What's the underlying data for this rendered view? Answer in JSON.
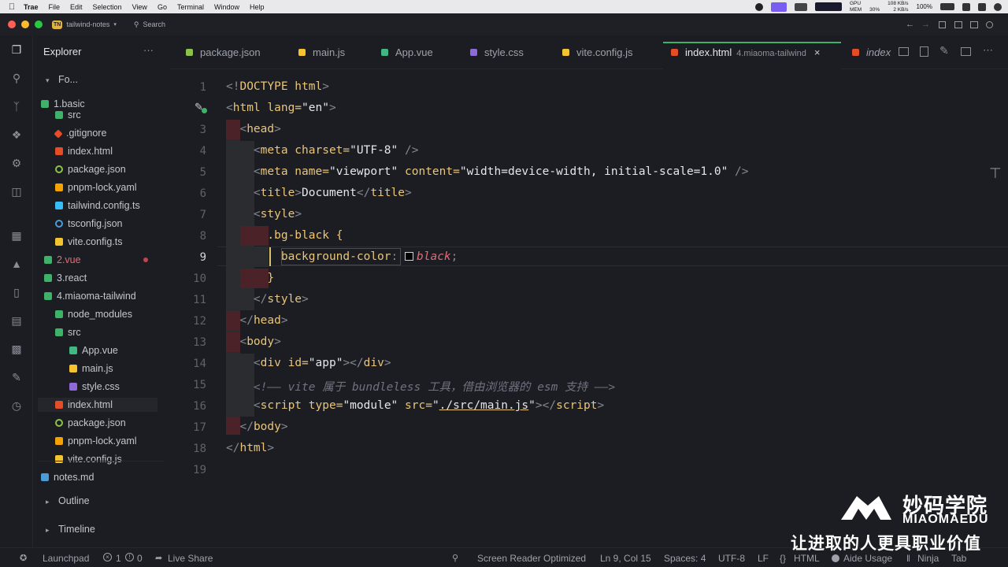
{
  "menubar": {
    "items": [
      "Trae",
      "File",
      "Edit",
      "Selection",
      "View",
      "Go",
      "Terminal",
      "Window",
      "Help"
    ],
    "gpu_label": "GPU",
    "mem_label": "MEM",
    "mem_value": "30%",
    "net_up": "108 KB/s",
    "net_down": "2 KB/s",
    "battery": "100%"
  },
  "titlebar": {
    "project_badge": "TN",
    "project_name": "tailwind-notes",
    "search_label": "Search"
  },
  "sidebar": {
    "title": "Explorer",
    "more": "···",
    "root_label": "Fo...",
    "outline_label": "Outline",
    "timeline_label": "Timeline",
    "rows": [
      {
        "label": "1.basic",
        "kind": "folder"
      },
      {
        "label": "src",
        "kind": "folder-src"
      },
      {
        "label": ".gitignore",
        "kind": "git"
      },
      {
        "label": "index.html",
        "kind": "html"
      },
      {
        "label": "package.json",
        "kind": "json"
      },
      {
        "label": "pnpm-lock.yaml",
        "kind": "yaml"
      },
      {
        "label": "tailwind.config.ts",
        "kind": "tw"
      },
      {
        "label": "tsconfig.json",
        "kind": "json-blue"
      },
      {
        "label": "vite.config.ts",
        "kind": "vite"
      },
      {
        "label": "2.vue",
        "kind": "folder-mod"
      },
      {
        "label": "3.react",
        "kind": "folder"
      },
      {
        "label": "4.miaoma-tailwind",
        "kind": "folder"
      },
      {
        "label": "node_modules",
        "kind": "folder"
      },
      {
        "label": "src",
        "kind": "folder-src"
      },
      {
        "label": "App.vue",
        "kind": "vue"
      },
      {
        "label": "main.js",
        "kind": "js"
      },
      {
        "label": "style.css",
        "kind": "css"
      },
      {
        "label": "index.html",
        "kind": "html"
      },
      {
        "label": "package.json",
        "kind": "json"
      },
      {
        "label": "pnpm-lock.yaml",
        "kind": "yaml"
      },
      {
        "label": "vite.config.js",
        "kind": "vite"
      },
      {
        "label": "notes.md",
        "kind": "md"
      }
    ]
  },
  "tabs": [
    {
      "label": "package.json",
      "color": "#8bc34a"
    },
    {
      "label": "main.js",
      "color": "#f4c430"
    },
    {
      "label": "App.vue",
      "color": "#41b883"
    },
    {
      "label": "style.css",
      "color": "#8e6ad8"
    },
    {
      "label": "vite.config.js",
      "color": "#f4c430"
    },
    {
      "label": "index.html",
      "color": "#e44d26",
      "hint": "4.miaoma-tailwind",
      "close": "×"
    },
    {
      "label": "index",
      "color": "#e44d26"
    }
  ],
  "editor": {
    "line_numbers": [
      "1",
      "2",
      "3",
      "4",
      "5",
      "6",
      "7",
      "8",
      "9",
      "10",
      "11",
      "12",
      "13",
      "14",
      "15",
      "16",
      "17",
      "18",
      "19"
    ],
    "code": {
      "l1a": "<!",
      "l1b": "DOCTYPE html",
      "l1c": ">",
      "l2a": "<",
      "l2b": "html",
      "l2c": " lang=",
      "l2d": "\"en\"",
      "l2e": ">",
      "l3a": "<",
      "l3b": "head",
      "l3c": ">",
      "l4a": "<",
      "l4b": "meta",
      "l4c": " charset=",
      "l4d": "\"UTF-8\"",
      "l4e": " />",
      "l5a": "<",
      "l5b": "meta",
      "l5c": " name=",
      "l5d": "\"viewport\"",
      "l5e": " content=",
      "l5f": "\"width=device-width, initial-scale=1.0\"",
      "l5g": " />",
      "l6a": "<",
      "l6b": "title",
      "l6c": ">",
      "l6d": "Document",
      "l6e": "</",
      "l6f": "title",
      "l6g": ">",
      "l7a": "<",
      "l7b": "style",
      "l7c": ">",
      "l8a": ".bg-black",
      "l8b": " {",
      "l9a": "background-color",
      "l9b": ": ",
      "l9c": "black",
      "l9d": ";",
      "l10a": "}",
      "l11a": "</",
      "l11b": "style",
      "l11c": ">",
      "l12a": "</",
      "l12b": "head",
      "l12c": ">",
      "l13a": "<",
      "l13b": "body",
      "l13c": ">",
      "l14a": "<",
      "l14b": "div",
      "l14c": " id=",
      "l14d": "\"app\"",
      "l14e": "></",
      "l14f": "div",
      "l14g": ">",
      "l15a": "<!—— vite 属于 bundleless 工具，借由浏览器的 esm 支持 ——>",
      "l16a": "<",
      "l16b": "script",
      "l16c": " type=",
      "l16d": "\"module\"",
      "l16e": " src=",
      "l16f": "\"",
      "l16g": "./src/main.js",
      "l16h": "\"",
      "l16i": "></",
      "l16j": "script",
      "l16k": ">",
      "l17a": "</",
      "l17b": "body",
      "l17c": ">",
      "l18a": "</",
      "l18b": "html",
      "l18c": ">"
    }
  },
  "statusbar": {
    "launchpad": "Launchpad",
    "errors": "1",
    "warnings": "0",
    "live_share": "Live Share",
    "screen_reader": "Screen Reader Optimized",
    "position": "Ln 9, Col 15",
    "spaces": "Spaces: 4",
    "encoding": "UTF-8",
    "eol": "LF",
    "language": "HTML",
    "aide": "Aide Usage",
    "ninja": "Ninja",
    "tab": "Tab"
  },
  "watermark": {
    "brand_cn": "妙码学院",
    "brand_en": "MIAOMAEDU",
    "slogan": "让进取的人更具职业价值"
  }
}
